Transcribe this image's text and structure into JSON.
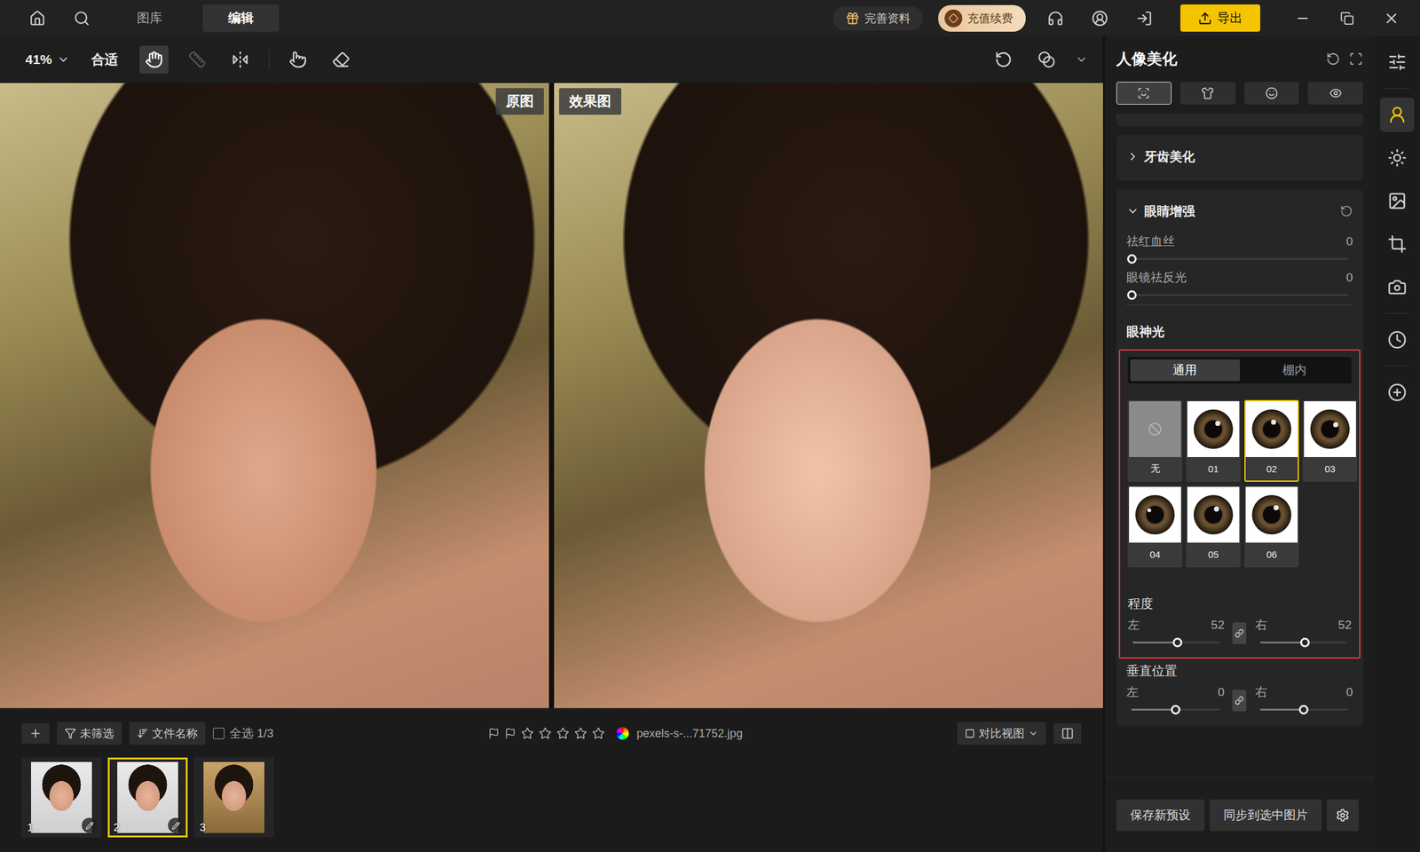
{
  "top_bar": {
    "nav": [
      {
        "label": "图库",
        "selected": false
      },
      {
        "label": "编辑",
        "selected": true
      }
    ],
    "profile": "完善资料",
    "recharge": "充值续费",
    "export": "导出"
  },
  "toolbar": {
    "zoom": "41%",
    "fit": "合适",
    "tools": [
      {
        "kind": "hand",
        "selected": true,
        "disabled": false
      },
      {
        "kind": "ruler",
        "selected": false,
        "disabled": true
      },
      {
        "kind": "flip",
        "selected": false,
        "disabled": false
      },
      {
        "kind": "touch",
        "selected": false,
        "disabled": false
      },
      {
        "kind": "eraser",
        "selected": false,
        "disabled": false
      }
    ]
  },
  "compare": {
    "labels": [
      "原图",
      "效果图"
    ]
  },
  "filmstrip": {
    "filter": "未筛选",
    "sort": "文件名称",
    "select_all": {
      "label": "全选 1/3",
      "checked": false
    },
    "stars": 0,
    "filename": "pexels-s-...71752.jpg",
    "view": "对比视图",
    "thumbnails": [
      {
        "index": "1",
        "selected": false,
        "edited": true
      },
      {
        "index": "2",
        "selected": true,
        "edited": true
      },
      {
        "index": "3",
        "selected": false,
        "edited": false
      }
    ]
  },
  "panel": {
    "title": "人像美化",
    "tabs": [
      {
        "kind": "face",
        "selected": true
      },
      {
        "kind": "body",
        "selected": false
      },
      {
        "kind": "smile",
        "selected": false
      },
      {
        "kind": "eye",
        "selected": false
      }
    ],
    "sections": [
      {
        "title": "牙齿美化",
        "expanded": false,
        "sliders": []
      },
      {
        "title": "眼睛增强",
        "expanded": true,
        "sliders": [
          {
            "label": "祛红血丝",
            "value": "0",
            "level": 0
          },
          {
            "label": "眼镜祛反光",
            "value": "0",
            "level": 0
          }
        ]
      }
    ],
    "catchlight": {
      "title": "眼神光",
      "tabs": [
        {
          "label": "通用",
          "selected": true
        },
        {
          "label": "棚内",
          "selected": false
        }
      ],
      "presets": [
        {
          "label": "无",
          "kind": "none",
          "selected": false
        },
        {
          "label": "01",
          "kind": "eye",
          "selected": false
        },
        {
          "label": "02",
          "kind": "eye",
          "selected": true
        },
        {
          "label": "03",
          "kind": "eye",
          "selected": false
        },
        {
          "label": "04",
          "kind": "eye",
          "selected": false
        },
        {
          "label": "05",
          "kind": "eye",
          "selected": false
        },
        {
          "label": "06",
          "kind": "eye",
          "selected": false
        }
      ],
      "pairs": [
        {
          "title": "程度",
          "linked": true,
          "highlighted": true,
          "left": {
            "label": "左",
            "value": "52",
            "level": 0.52
          },
          "right": {
            "label": "右",
            "value": "52",
            "level": 0.52
          }
        },
        {
          "title": "垂直位置",
          "linked": true,
          "highlighted": false,
          "left": {
            "label": "左",
            "value": "0",
            "level": 0.5
          },
          "right": {
            "label": "右",
            "value": "0",
            "level": 0.5
          }
        }
      ]
    },
    "buttons": [
      "保存新预设",
      "同步到选中图片"
    ]
  },
  "side_tools": [
    {
      "kind": "adjust",
      "selected": false
    },
    {
      "kind": "portrait",
      "selected": true
    },
    {
      "kind": "light",
      "selected": false
    },
    {
      "kind": "image",
      "selected": false
    },
    {
      "kind": "crop",
      "selected": false
    },
    {
      "kind": "camera",
      "selected": false
    },
    {
      "kind": "history",
      "selected": false
    },
    {
      "kind": "add",
      "selected": false
    }
  ]
}
